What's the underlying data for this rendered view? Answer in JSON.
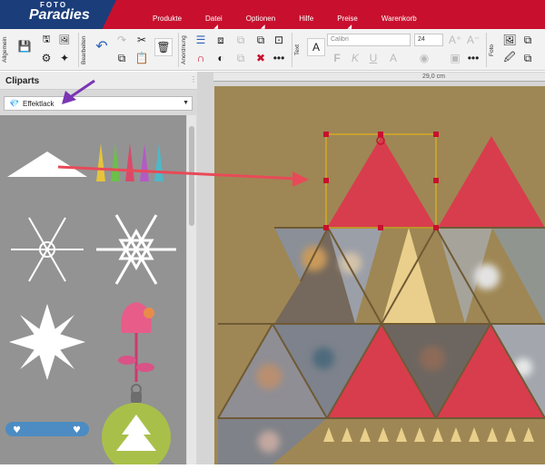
{
  "header": {
    "logo_top": "FOTO",
    "logo_main": "Paradies",
    "menu": [
      {
        "label": "Produkte",
        "dropdown": false
      },
      {
        "label": "Datei",
        "dropdown": true
      },
      {
        "label": "Optionen",
        "dropdown": true
      },
      {
        "label": "Hilfe",
        "dropdown": false
      },
      {
        "label": "Preise",
        "dropdown": true
      },
      {
        "label": "Warenkorb",
        "dropdown": false
      }
    ],
    "brand_red": "#c8102e",
    "brand_blue": "#1b3d7a"
  },
  "toolbar": {
    "groups": [
      "Allgemein",
      "Bearbeiten",
      "Anordnung",
      "Text",
      "Foto"
    ],
    "font_name": "Calibri",
    "font_size": "24"
  },
  "sidebar": {
    "title": "Cliparts",
    "category": "Effektlack",
    "items": [
      "triangle-clipart",
      "christmas-trees-clipart",
      "snowflake-1-clipart",
      "snowflake-2-clipart",
      "snowflake-3-clipart",
      "flower-clipart",
      "hearts-banner-clipart",
      "ornament-tree-clipart"
    ]
  },
  "canvas": {
    "ruler_label": "29,0 cm",
    "page_color": "#9e8754",
    "triangle_red": "#d83d4d",
    "triangle_beige": "#e9cf8b",
    "photo_tiles": 8
  },
  "annotations": {
    "arrow_color": "#e84a58",
    "pointer_color": "#7a35b5"
  }
}
